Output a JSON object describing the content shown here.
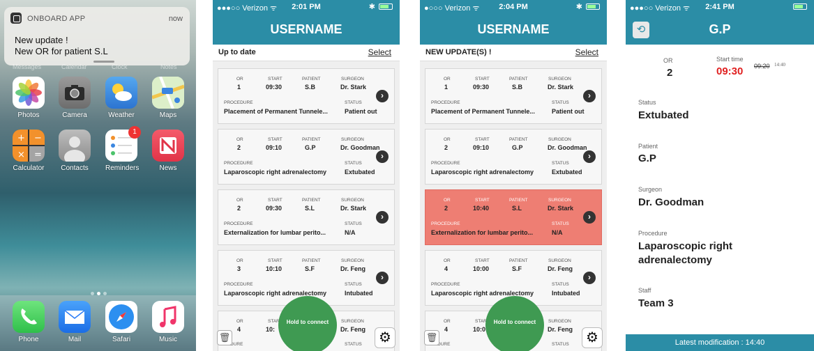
{
  "lock": {
    "app_name": "ONBOARD APP",
    "time": "now",
    "line1": "New update !",
    "line2": "New OR for patient S.L",
    "widgets_row": [
      "Messages",
      "Calendar",
      "Clock",
      "Notes"
    ],
    "apps": [
      {
        "label": "Photos",
        "icon": "photos-icon",
        "color": "#ffffff"
      },
      {
        "label": "Camera",
        "icon": "camera-icon",
        "color": "#8a8a8a"
      },
      {
        "label": "Weather",
        "icon": "weather-icon",
        "color": "#3a8de0"
      },
      {
        "label": "Maps",
        "icon": "maps-icon",
        "color": "#7dc36b"
      },
      {
        "label": "Calculator",
        "icon": "calculator-icon",
        "color": "#f2912c"
      },
      {
        "label": "Contacts",
        "icon": "contacts-icon",
        "color": "#a0a0a0"
      },
      {
        "label": "Reminders",
        "icon": "reminders-icon",
        "color": "#ffffff",
        "badge": "1"
      },
      {
        "label": "News",
        "icon": "news-icon",
        "color": "#ee4153"
      }
    ],
    "dock": [
      {
        "label": "Phone",
        "icon": "phone-icon",
        "color": "#4cd964"
      },
      {
        "label": "Mail",
        "icon": "mail-icon",
        "color": "#2d7ef7"
      },
      {
        "label": "Safari",
        "icon": "safari-icon",
        "color": "#ffffff"
      },
      {
        "label": "Music",
        "icon": "music-icon",
        "color": "#ffffff"
      }
    ]
  },
  "screen2": {
    "carrier": "●●●○○ Verizon ᯤ",
    "time": "2:01 PM",
    "title": "USERNAME",
    "status_text": "Up to date",
    "select": "Select",
    "cards": [
      {
        "or": "1",
        "start": "09:30",
        "patient": "S.B",
        "surgeon": "Dr. Stark",
        "procedure": "Placement of Permanent Tunnele...",
        "status": "Patient out"
      },
      {
        "or": "2",
        "start": "09:10",
        "patient": "G.P",
        "surgeon": "Dr. Goodman",
        "procedure": "Laparoscopic right adrenalectomy",
        "status": "Extubated"
      },
      {
        "or": "2",
        "start": "09:30",
        "patient": "S.L",
        "surgeon": "Dr. Stark",
        "procedure": "Externalization for lumbar perito...",
        "status": "N/A"
      },
      {
        "or": "3",
        "start": "10:10",
        "patient": "S.F",
        "surgeon": "Dr. Feng",
        "procedure": "Laparoscopic right adrenalectomy",
        "status": "Intubated"
      },
      {
        "or": "4",
        "start": "10:",
        "patient": "",
        "surgeon": "Dr. Feng",
        "procedure": "",
        "status": ""
      }
    ]
  },
  "screen3": {
    "carrier": "●○○○ Verizon ᯤ",
    "time": "2:04 PM",
    "title": "USERNAME",
    "status_text": "NEW UPDATE(S) !",
    "select": "Select",
    "cards": [
      {
        "or": "1",
        "start": "09:30",
        "patient": "S.B",
        "surgeon": "Dr. Stark",
        "procedure": "Placement of Permanent Tunnele...",
        "status": "Patient out"
      },
      {
        "or": "2",
        "start": "09:10",
        "patient": "G.P",
        "surgeon": "Dr. Goodman",
        "procedure": "Laparoscopic right adrenalectomy",
        "status": "Extubated"
      },
      {
        "or": "2",
        "start": "10:40",
        "patient": "S.L",
        "surgeon": "Dr. Stark",
        "procedure": "Externalization for lumbar perito...",
        "status": "N/A",
        "highlight": true
      },
      {
        "or": "4",
        "start": "10:00",
        "patient": "S.F",
        "surgeon": "Dr. Feng",
        "procedure": "Laparoscopic right adrenalectomy",
        "status": "Intubated"
      },
      {
        "or": "4",
        "start": "10:0",
        "patient": "",
        "surgeon": "Dr. Feng",
        "procedure": "",
        "status": ""
      }
    ]
  },
  "labels": {
    "or": "OR",
    "start": "START",
    "patient": "PATIENT",
    "surgeon": "SURGEON",
    "procedure": "PROCEDURE",
    "status": "STATUS",
    "procedure_cut": "CEDURE"
  },
  "connect_label": "Hold to connect",
  "accent_color": "#2b8da6",
  "highlight_color": "#ee7e73",
  "connect_color": "#3f9a52",
  "detail": {
    "carrier": "●●●○○ Verizon ᯤ",
    "time": "2:41 PM",
    "title": "G.P",
    "or_label": "OR",
    "or_value": "2",
    "start_label": "Start time",
    "start_value": "09:30",
    "old_start": "09:20",
    "old_time_small": "14:40",
    "status_label": "Status",
    "status_value": "Extubated",
    "patient_label": "Patient",
    "patient_value": "G.P",
    "surgeon_label": "Surgeon",
    "surgeon_value": "Dr. Goodman",
    "procedure_label": "Procedure",
    "procedure_line1": "Laparoscopic right",
    "procedure_line2": "adrenalectomy",
    "staff_label": "Staff",
    "staff_value": "Team 3",
    "footer": "Latest modification : 14:40"
  }
}
